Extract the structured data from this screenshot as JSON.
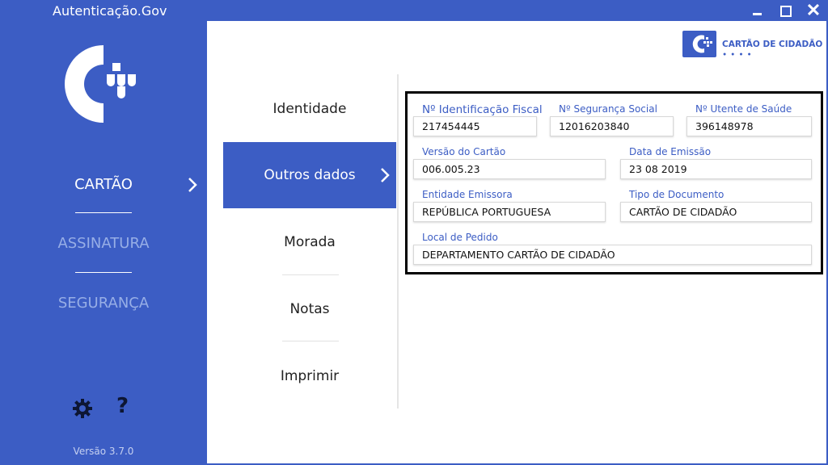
{
  "window": {
    "title": "Autenticação.Gov",
    "minimize_icon": "minimize-icon",
    "maximize_icon": "maximize-icon",
    "close_icon": "close-icon",
    "close_glyph": "✕"
  },
  "sidebar": {
    "logo_icon": "cartao-cidadao-logo",
    "items": [
      {
        "label": "CARTÃO",
        "active": true
      },
      {
        "label": "ASSINATURA",
        "active": false
      },
      {
        "label": "SEGURANÇA",
        "active": false
      }
    ],
    "settings_icon": "gear-icon",
    "help_label": "?",
    "version": "Versão 3.7.0"
  },
  "brand": {
    "name": "CARTÃO DE CIDADÃO",
    "dots": "● ● ● ●"
  },
  "submenu": {
    "items": [
      {
        "label": "Identidade",
        "active": false
      },
      {
        "label": "Outros dados",
        "active": true
      },
      {
        "label": "Morada",
        "active": false
      },
      {
        "label": "Notas",
        "active": false
      },
      {
        "label": "Imprimir",
        "active": false
      }
    ]
  },
  "fields": {
    "nif": {
      "label": "Nº Identificação Fiscal",
      "value": "217454445"
    },
    "niss": {
      "label": "Nº Segurança Social",
      "value": "12016203840"
    },
    "nus": {
      "label": "Nº Utente de Saúde",
      "value": "396148978"
    },
    "versao": {
      "label": "Versão do Cartão",
      "value": "006.005.23"
    },
    "emissao": {
      "label": "Data de Emissão",
      "value": "23 08 2019"
    },
    "entidade": {
      "label": "Entidade Emissora",
      "value": "REPÚBLICA PORTUGUESA"
    },
    "tipo": {
      "label": "Tipo de Documento",
      "value": "CARTÃO DE CIDADÃO"
    },
    "local": {
      "label": "Local de Pedido",
      "value": "DEPARTAMENTO CARTÃO DE CIDADÃO"
    }
  },
  "colors": {
    "accent": "#3c5dc4",
    "inactive_nav": "#97aee6"
  }
}
